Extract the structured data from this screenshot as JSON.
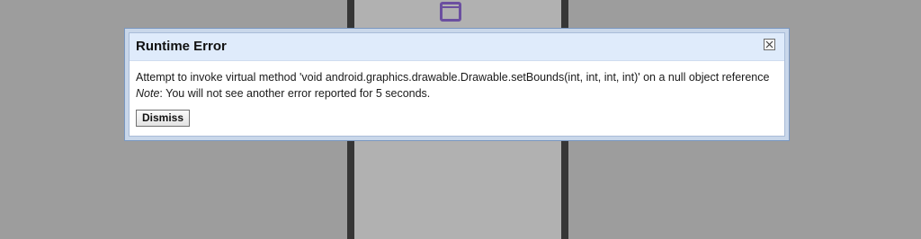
{
  "dialog": {
    "title": "Runtime Error",
    "message": "Attempt to invoke virtual method 'void android.graphics.drawable.Drawable.setBounds(int, int, int, int)' on a null object reference",
    "note_label": "Note",
    "note_text": ": You will not see another error reported for 5 seconds.",
    "dismiss_label": "Dismiss",
    "close_icon": "close-icon"
  },
  "background": {
    "icon": "window-icon",
    "accent_color": "#6b4fa0"
  }
}
